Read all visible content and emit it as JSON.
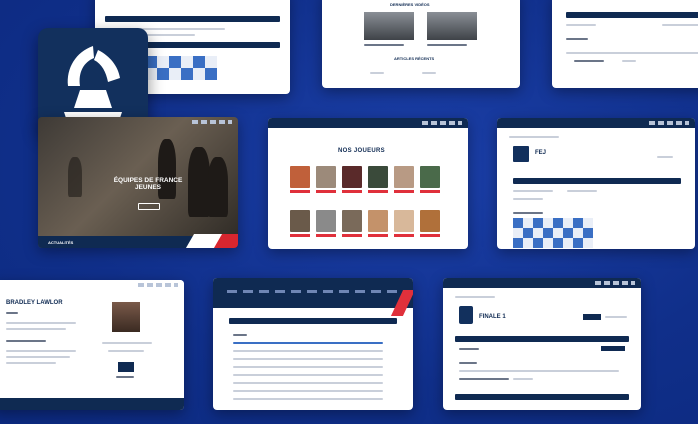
{
  "screens": {
    "hero": {
      "title": "ÉQUIPES DE FRANCE JEUNES",
      "cta": "",
      "footer_label": "ACTUALITÉS"
    },
    "players": {
      "title": "NOS JOUEURS"
    },
    "club": {
      "name": "FEJ"
    },
    "player_profile": {
      "name": "BRADLEY LAWLOR"
    },
    "news": {
      "section_title": "DERNIÈRES VIDÉOS",
      "secondary_title": "ARTICLES RÉCENTS"
    },
    "team": {
      "name": "FINALE 1"
    }
  },
  "colors": {
    "background": "#0f2f8c",
    "navy": "#0f2a52",
    "red": "#e0303b",
    "blue_square": "#3a6fc4"
  },
  "icons": [
    "chess-knight-logo-icon",
    "king-icon",
    "menu-icon"
  ]
}
